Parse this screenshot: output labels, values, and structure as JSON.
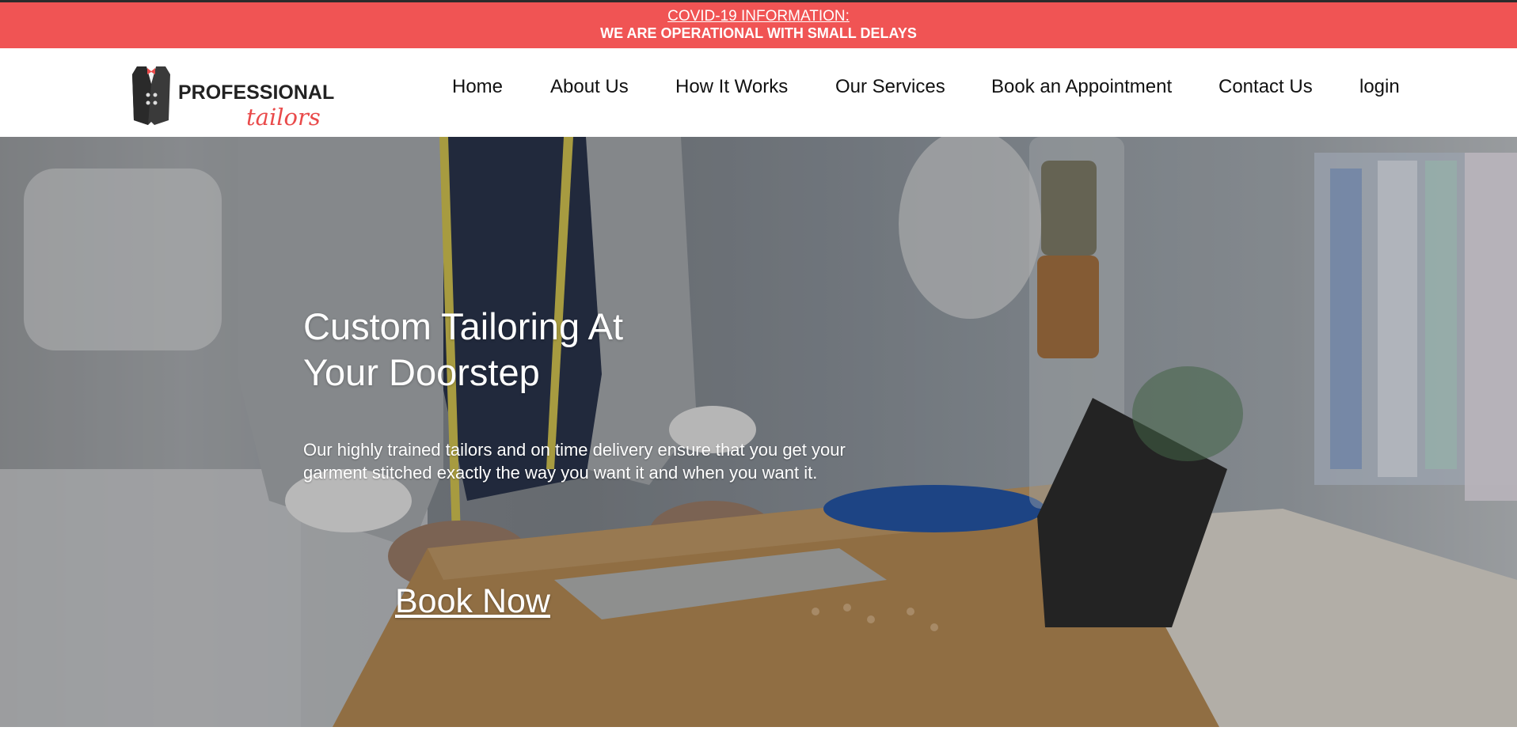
{
  "covid_bar": {
    "link_text": "COVID-19 INFORMATION:",
    "message": "WE ARE OPERATIONAL WITH SMALL DELAYS",
    "color": "#f05454"
  },
  "logo": {
    "top_text": "PROFESSIONAL",
    "bottom_text": "tailors",
    "icon": "vest-icon",
    "accent_color": "#e94a4a"
  },
  "nav": {
    "items": [
      {
        "label": "Home"
      },
      {
        "label": "About Us"
      },
      {
        "label": "How It Works"
      },
      {
        "label": "Our Services"
      },
      {
        "label": "Book an Appointment"
      },
      {
        "label": "Contact Us"
      },
      {
        "label": "login"
      }
    ]
  },
  "hero": {
    "title_line1": "Custom Tailoring At",
    "title_line2": "Your Doorstep",
    "description": "Our highly trained tailors and on time delivery ensure that you get your garment stitched exactly the way you want it and when you want it.",
    "cta_label": "Book Now"
  }
}
